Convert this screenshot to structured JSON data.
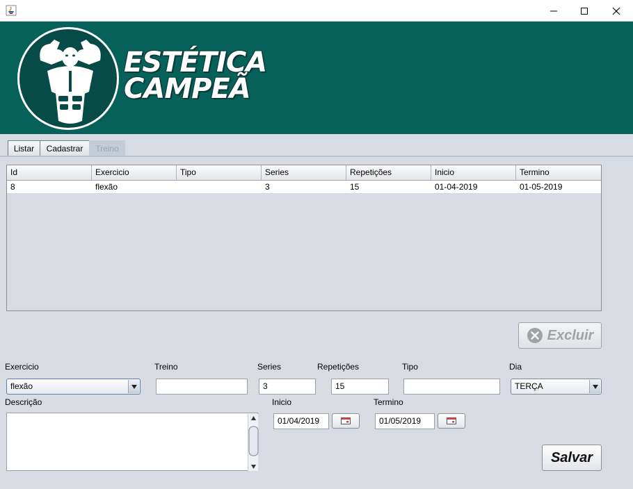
{
  "window": {
    "minimize_glyph": "—",
    "maximize_glyph": "☐",
    "close_glyph": "✕"
  },
  "brand": {
    "line1": "ESTÉTICA",
    "line2": "CAMPEÃ"
  },
  "tabs": [
    {
      "label": "Listar"
    },
    {
      "label": "Cadastrar"
    },
    {
      "label": "Treino"
    }
  ],
  "table": {
    "columns": [
      "Id",
      "Exercicio",
      "Tipo",
      "Series",
      "Repetições",
      "Inicio",
      "Termino"
    ],
    "rows": [
      [
        "8",
        "flexão",
        "",
        "3",
        "15",
        "01-04-2019",
        "01-05-2019"
      ]
    ]
  },
  "buttons": {
    "excluir": "Excluir",
    "salvar": "Salvar"
  },
  "form": {
    "exercicio_label": "Exercicio",
    "exercicio_value": "flexão",
    "treino_label": "Treino",
    "treino_value": "",
    "series_label": "Series",
    "series_value": "3",
    "repeticoes_label": "Repetições",
    "repeticoes_value": "15",
    "tipo_label": "Tipo",
    "tipo_value": "",
    "dia_label": "Dia",
    "dia_value": "TERÇA",
    "descricao_label": "Descrição",
    "descricao_value": "",
    "inicio_label": "Inicio",
    "inicio_value": "01/04/2019",
    "termino_label": "Termino",
    "termino_value": "01/05/2019"
  },
  "colors": {
    "banner": "#06615b",
    "background": "#d8dbe2"
  }
}
